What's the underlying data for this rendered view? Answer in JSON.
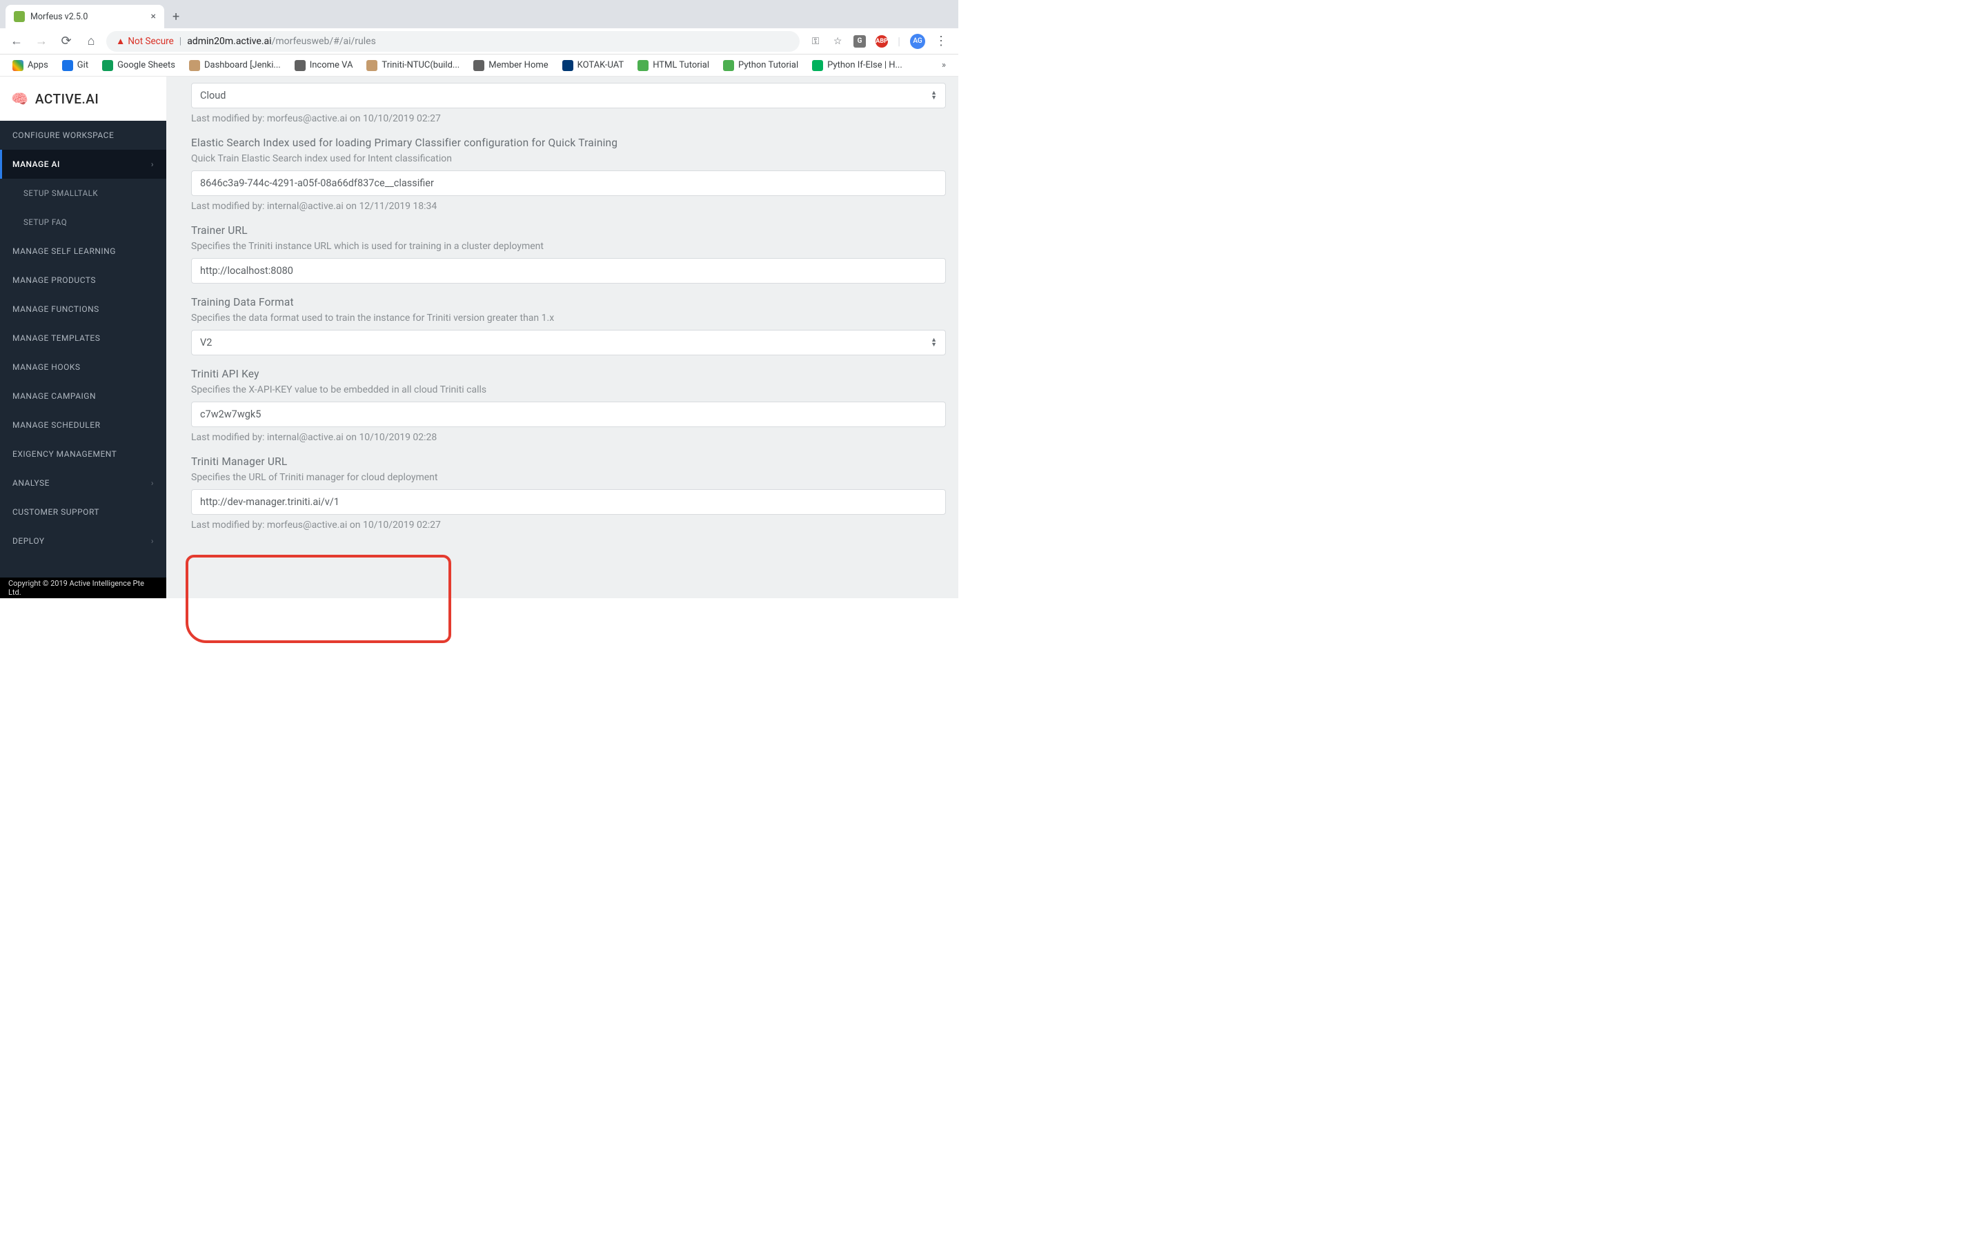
{
  "browser": {
    "tab_title": "Morfeus v2.5.0",
    "security_label": "Not Secure",
    "url_domain": "admin20m.active.ai",
    "url_path": "/morfeusweb/#/ai/rules",
    "avatar_initials": "AG",
    "ext_g": "G",
    "ext_abp": "ABP",
    "apps_label": "Apps",
    "bookmarks": [
      {
        "label": "Git",
        "color": "#1a73e8"
      },
      {
        "label": "Google Sheets",
        "color": "#0f9d58"
      },
      {
        "label": "Dashboard [Jenki...",
        "color": "#c59b6d"
      },
      {
        "label": "Income VA",
        "color": "#616161"
      },
      {
        "label": "Triniti-NTUC(build...",
        "color": "#c59b6d"
      },
      {
        "label": "Member Home",
        "color": "#616161"
      },
      {
        "label": "KOTAK-UAT",
        "color": "#003874"
      },
      {
        "label": "HTML Tutorial",
        "color": "#4caf50"
      },
      {
        "label": "Python Tutorial",
        "color": "#4caf50"
      },
      {
        "label": "Python If-Else | H...",
        "color": "#00b15c"
      }
    ]
  },
  "brand": {
    "name": "ACTIVE.AI"
  },
  "sidebar": [
    {
      "label": "CONFIGURE WORKSPACE",
      "type": "item"
    },
    {
      "label": "MANAGE AI",
      "type": "item",
      "active": true,
      "expand": true
    },
    {
      "label": "SETUP SMALLTALK",
      "type": "sub"
    },
    {
      "label": "SETUP FAQ",
      "type": "sub"
    },
    {
      "label": "MANAGE SELF LEARNING",
      "type": "item"
    },
    {
      "label": "MANAGE PRODUCTS",
      "type": "item"
    },
    {
      "label": "MANAGE FUNCTIONS",
      "type": "item"
    },
    {
      "label": "MANAGE TEMPLATES",
      "type": "item"
    },
    {
      "label": "MANAGE HOOKS",
      "type": "item"
    },
    {
      "label": "MANAGE CAMPAIGN",
      "type": "item"
    },
    {
      "label": "MANAGE SCHEDULER",
      "type": "item"
    },
    {
      "label": "EXIGENCY MANAGEMENT",
      "type": "item"
    },
    {
      "label": "ANALYSE",
      "type": "item",
      "expand": true
    },
    {
      "label": "CUSTOMER SUPPORT",
      "type": "item"
    },
    {
      "label": "DEPLOY",
      "type": "item",
      "expand": true
    }
  ],
  "footer": "Copyright © 2019 Active Intelligence Pte Ltd.",
  "form": {
    "f0": {
      "value": "Cloud",
      "type": "select",
      "modified": "Last modified by: morfeus@active.ai on 10/10/2019 02:27"
    },
    "f1": {
      "title": "Elastic Search Index used for loading Primary Classifier configuration for Quick Training",
      "desc": "Quick Train Elastic Search index used for Intent classification",
      "value": "8646c3a9-744c-4291-a05f-08a66df837ce__classifier",
      "type": "input",
      "modified": "Last modified by: internal@active.ai on 12/11/2019 18:34"
    },
    "f2": {
      "title": "Trainer URL",
      "desc": "Specifies the Triniti instance URL which is used for training in a cluster deployment",
      "value": "http://localhost:8080",
      "type": "input"
    },
    "f3": {
      "title": "Training Data Format",
      "desc": "Specifies the data format used to train the instance for Triniti version greater than 1.x",
      "value": "V2",
      "type": "select"
    },
    "f4": {
      "title": "Triniti API Key",
      "desc": "Specifies the X-API-KEY value to be embedded in all cloud Triniti calls",
      "value": "c7w2w7wgk5",
      "type": "input",
      "modified": "Last modified by: internal@active.ai on 10/10/2019 02:28"
    },
    "f5": {
      "title": "Triniti Manager URL",
      "desc": "Specifies the URL of Triniti manager for cloud deployment",
      "value": "http://dev-manager.triniti.ai/v/1",
      "type": "input",
      "modified": "Last modified by: morfeus@active.ai on 10/10/2019 02:27"
    }
  }
}
